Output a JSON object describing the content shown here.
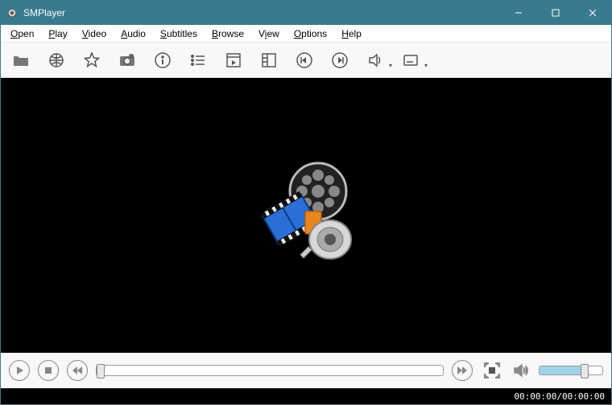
{
  "window": {
    "title": "SMPlayer"
  },
  "menu": {
    "open": "Open",
    "play": "Play",
    "video": "Video",
    "audio": "Audio",
    "subtitles": "Subtitles",
    "browse": "Browse",
    "view": "View",
    "options": "Options",
    "help": "Help"
  },
  "toolbar": {
    "open_file": "open-folder-icon",
    "open_url": "globe-icon",
    "favorites": "star-icon",
    "screenshot": "camera-icon",
    "info": "info-icon",
    "playlist": "list-icon",
    "preferences": "film-icon",
    "tube": "panel-icon",
    "prev": "skip-previous-icon",
    "next": "skip-next-icon",
    "audio_track": "speaker-dropdown-icon",
    "subtitle_track": "subtitle-dropdown-icon"
  },
  "playback": {
    "current_time": "00:00:00",
    "total_time": "00:00:00",
    "separator": " / "
  }
}
